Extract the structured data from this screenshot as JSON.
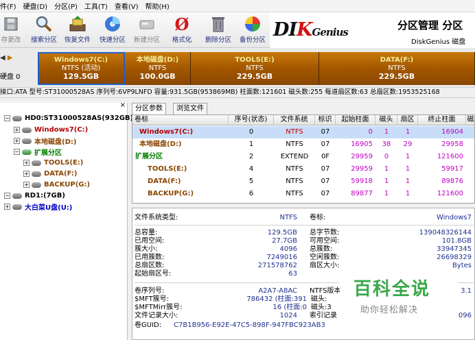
{
  "menu": [
    "件(F)",
    "硬盘(D)",
    "分区(P)",
    "工具(T)",
    "查看(V)",
    "帮助(H)"
  ],
  "toolbar": {
    "items": [
      {
        "label": "存更改",
        "icon": "save-changes-icon",
        "enabled": false
      },
      {
        "label": "搜索分区",
        "icon": "search-partition-icon",
        "enabled": true
      },
      {
        "label": "恢复文件",
        "icon": "recover-files-icon",
        "enabled": true
      },
      {
        "label": "快速分区",
        "icon": "quick-partition-icon",
        "enabled": true
      },
      {
        "label": "新建分区",
        "icon": "new-partition-icon",
        "enabled": false
      },
      {
        "label": "格式化",
        "icon": "format-icon",
        "enabled": true
      },
      {
        "label": "删除分区",
        "icon": "delete-partition-icon",
        "enabled": true
      },
      {
        "label": "备份分区",
        "icon": "backup-partition-icon",
        "enabled": true
      }
    ]
  },
  "brand": {
    "logo_a": "DI",
    "logo_b": "K",
    "logo_c": "Genius",
    "title": "分区管理 分区",
    "subtitle": "DiskGenius 磁盘"
  },
  "diskmap": {
    "disk_label": "硬盘 0",
    "partitions": [
      {
        "name": "Windows7(C:)",
        "fs": "NTFS (活动)",
        "size": "129.5GB",
        "selected": true
      },
      {
        "name": "本地磁盘(D:)",
        "fs": "NTFS",
        "size": "100.0GB",
        "selected": false
      },
      {
        "name": "TOOLS(E:)",
        "fs": "NTFS",
        "size": "229.5GB",
        "selected": false
      },
      {
        "name": "DATA(F:)",
        "fs": "NTFS",
        "size": "229.5GB",
        "selected": false
      }
    ]
  },
  "disk_info": "接口:ATA  型号:ST31000528AS  序列号:6VP9LNFD  容量:931.5GB(953869MB)  柱面数:121601  磁头数:255  每道扇区数:63  总扇区数:1953525168",
  "tree": {
    "nodes": [
      {
        "label": "HD0:ST31000528AS(932GB)",
        "color": "",
        "type": "disk"
      },
      {
        "label": "Windows7(C:)",
        "color": "red",
        "type": "part"
      },
      {
        "label": "本地磁盘(D:)",
        "color": "brown",
        "type": "part"
      },
      {
        "label": "扩展分区",
        "color": "green",
        "type": "ext"
      },
      {
        "label": "TOOLS(E:)",
        "color": "brown",
        "type": "part"
      },
      {
        "label": "DATA(F:)",
        "color": "brown",
        "type": "part"
      },
      {
        "label": "BACKUP(G:)",
        "color": "brown",
        "type": "part"
      },
      {
        "label": "RD1:(7GB)",
        "color": "",
        "type": "disk"
      },
      {
        "label": "大白菜U盘(U:)",
        "color": "blue",
        "type": "part"
      }
    ]
  },
  "tabs": [
    "分区参数",
    "浏览文件"
  ],
  "table": {
    "headers": [
      "卷标",
      "序号(状态)",
      "文件系统",
      "标识",
      "起始柱面",
      "磁头",
      "扇区",
      "终止柱面",
      "磁"
    ],
    "rows": [
      {
        "label": "Windows7(C:)",
        "num": "0",
        "fs": "NTFS",
        "id": "07",
        "start": "0",
        "head": "1",
        "sector": "1",
        "end": "16904",
        "color": "red",
        "selected": true
      },
      {
        "label": "本地磁盘(D:)",
        "num": "1",
        "fs": "NTFS",
        "id": "07",
        "start": "16905",
        "head": "38",
        "sector": "29",
        "end": "29958",
        "color": "brown",
        "selected": false
      },
      {
        "label": "扩展分区",
        "num": "2",
        "fs": "EXTEND",
        "id": "0F",
        "start": "29959",
        "head": "0",
        "sector": "1",
        "end": "121600",
        "color": "green",
        "selected": false
      },
      {
        "label": "TOOLS(E:)",
        "num": "4",
        "fs": "NTFS",
        "id": "07",
        "start": "29959",
        "head": "1",
        "sector": "1",
        "end": "59917",
        "color": "brown",
        "selected": false
      },
      {
        "label": "DATA(F:)",
        "num": "5",
        "fs": "NTFS",
        "id": "07",
        "start": "59918",
        "head": "1",
        "sector": "1",
        "end": "89876",
        "color": "brown",
        "selected": false
      },
      {
        "label": "BACKUP(G:)",
        "num": "6",
        "fs": "NTFS",
        "id": "07",
        "start": "89877",
        "head": "1",
        "sector": "1",
        "end": "121600",
        "color": "brown",
        "selected": false
      }
    ]
  },
  "details": {
    "fs_type_label": "文件系统类型:",
    "fs_type_value": "NTFS",
    "vol_label": "卷标:",
    "vol_value": "Windows7",
    "left": [
      {
        "k": "总容量:",
        "v": "129.5GB"
      },
      {
        "k": "已用空间:",
        "v": "27.7GB"
      },
      {
        "k": "簇大小:",
        "v": "4096"
      },
      {
        "k": "已用簇数:",
        "v": "7249016"
      },
      {
        "k": "总扇区数:",
        "v": "271578762"
      },
      {
        "k": "起始扇区号:",
        "v": "63"
      }
    ],
    "right": [
      {
        "k": "总字节数:",
        "v": "139048326144"
      },
      {
        "k": "可用空间:",
        "v": "101.8GB"
      },
      {
        "k": "总簇数:",
        "v": "33947345"
      },
      {
        "k": "空闲簇数:",
        "v": "26698329"
      },
      {
        "k": "扇区大小:",
        "v": "Bytes"
      }
    ],
    "left2": [
      {
        "k": "卷序列号:",
        "v": "A2A7-A8AC"
      },
      {
        "k": "$MFT簇号:",
        "v": "786432 (柱面:391"
      },
      {
        "k": "$MFTMirr簇号:",
        "v": "16 (柱面:0"
      },
      {
        "k": "文件记录大小:",
        "v": "1024"
      },
      {
        "k": "卷GUID:",
        "v": "C7B1B956-E92E-47C5-898F-947FBC923AB3"
      }
    ],
    "right2": [
      {
        "k": "NTFS版本",
        "v": "3.1"
      },
      {
        "k": "磁头:",
        "v": ""
      },
      {
        "k": "磁头:3",
        "v": ""
      },
      {
        "k": "索引记录",
        "v": "4096"
      }
    ]
  },
  "watermark": {
    "big": "百科全说",
    "small": "助你轻松解决"
  }
}
